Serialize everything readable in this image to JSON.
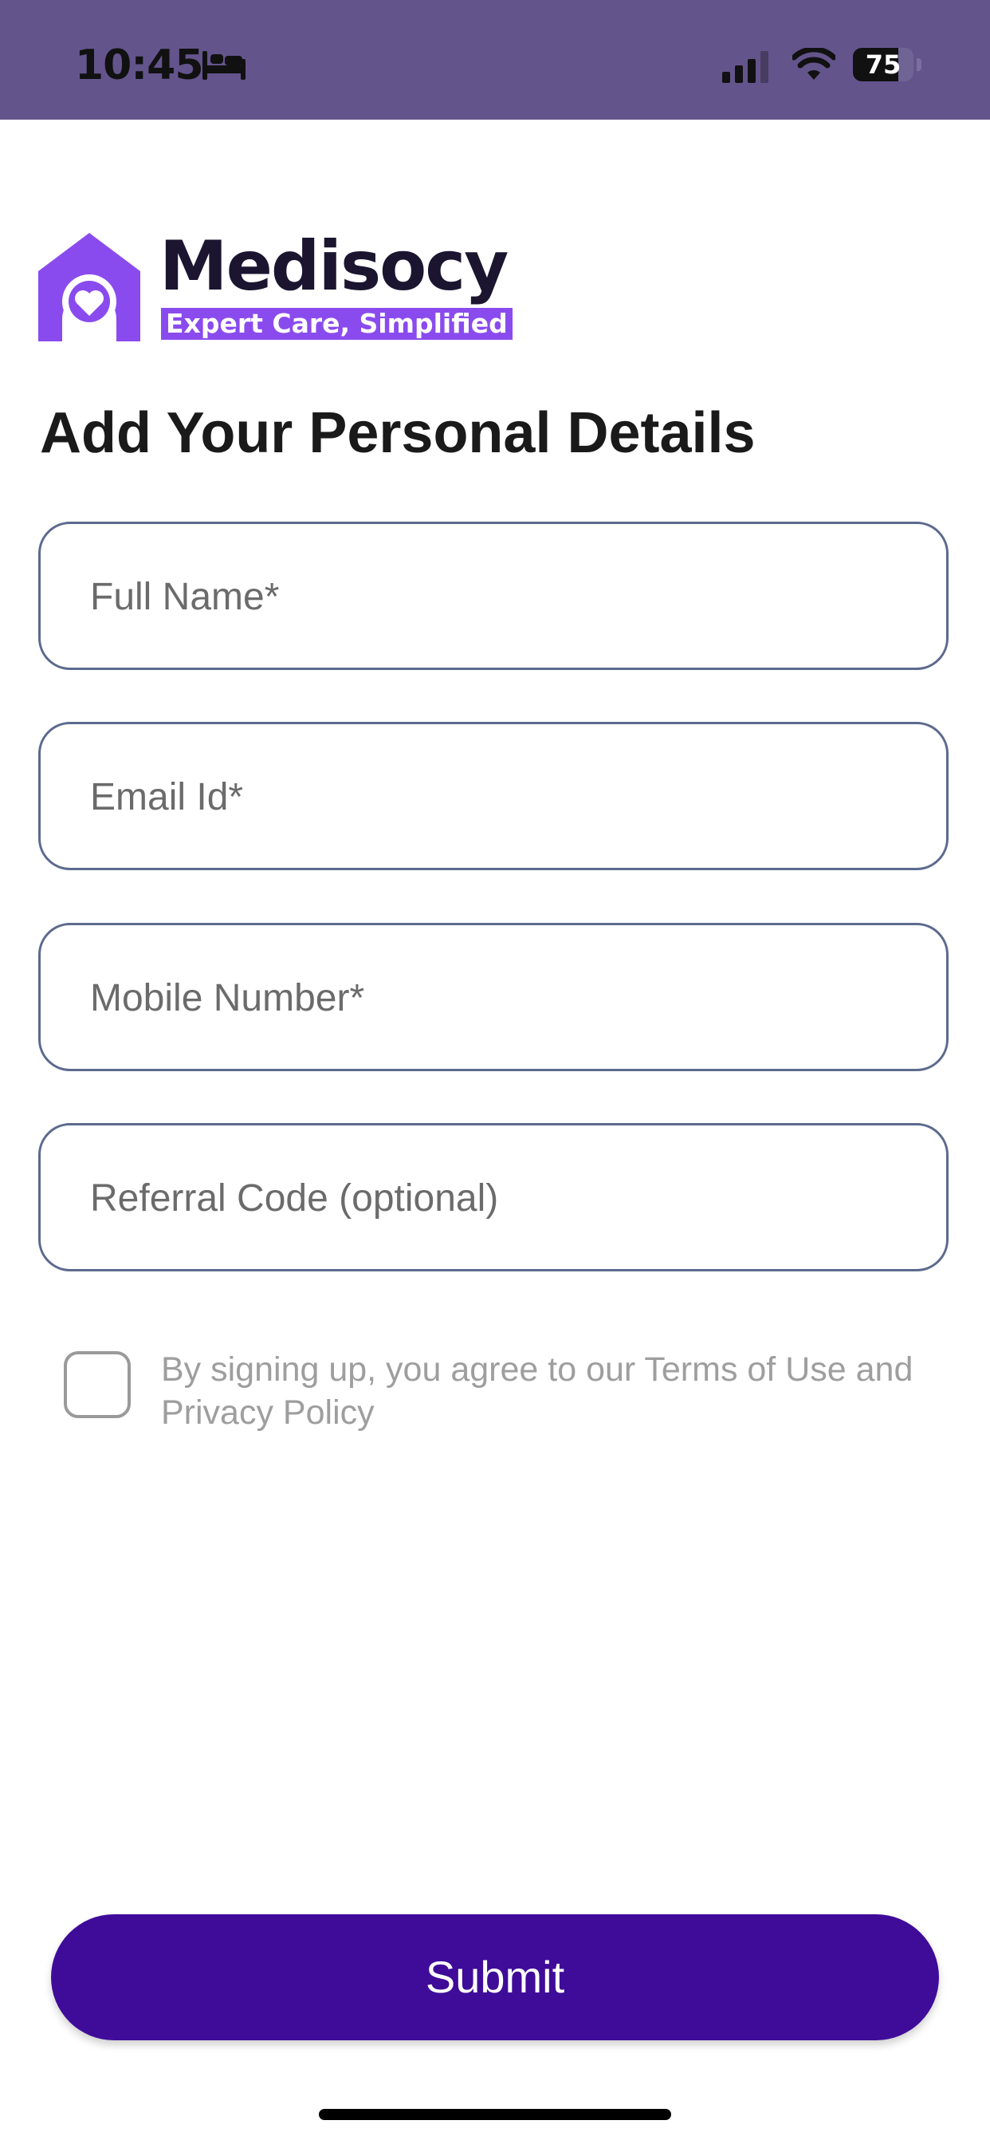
{
  "status_bar": {
    "time": "10:45",
    "battery_level": "75",
    "battery_fraction": 0.75,
    "icons": [
      "bed-icon",
      "cellular-signal-icon",
      "wifi-icon",
      "battery-icon"
    ],
    "background_color": "#64548C"
  },
  "brand": {
    "name": "Medisocy",
    "tagline": "Expert Care, Simplified",
    "logo_icon": "house-heart-icon",
    "accent_color": "#8A4BEE"
  },
  "form": {
    "title": "Add Your Personal Details",
    "fields": [
      {
        "placeholder": "Full Name*",
        "value": ""
      },
      {
        "placeholder": "Email Id*",
        "value": ""
      },
      {
        "placeholder": "Mobile Number*",
        "value": ""
      },
      {
        "placeholder": "Referral Code (optional)",
        "value": ""
      }
    ],
    "terms_checked": false,
    "terms_text": "By signing up, you agree to our Terms of Use and Privacy Policy",
    "submit_label": "Submit",
    "submit_color": "#3F0C99"
  }
}
